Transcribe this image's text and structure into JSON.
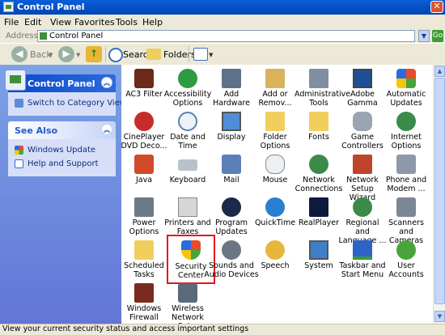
{
  "window": {
    "title": "Control Panel",
    "close_label": "✕"
  },
  "menu": [
    "File",
    "Edit",
    "View",
    "Favorites",
    "Tools",
    "Help"
  ],
  "address": {
    "label": "Address",
    "value": "Control Panel",
    "go_label": "Go"
  },
  "toolbar": {
    "back_label": "Back",
    "search_label": "Search",
    "folders_label": "Folders"
  },
  "sidebar": {
    "control_panel": {
      "title": "Control Panel",
      "link": "Switch to Category View"
    },
    "see_also": {
      "title": "See Also",
      "links": [
        "Windows Update",
        "Help and Support"
      ]
    }
  },
  "items": [
    {
      "label": "AC3 Filter"
    },
    {
      "label": "Accessibility Options"
    },
    {
      "label": "Add Hardware"
    },
    {
      "label": "Add or Remov..."
    },
    {
      "label": "Administrative Tools"
    },
    {
      "label": "Adobe Gamma"
    },
    {
      "label": "Automatic Updates"
    },
    {
      "label": "CinePlayer DVD Deco..."
    },
    {
      "label": "Date and Time"
    },
    {
      "label": "Display"
    },
    {
      "label": "Folder Options"
    },
    {
      "label": "Fonts"
    },
    {
      "label": "Game Controllers"
    },
    {
      "label": "Internet Options"
    },
    {
      "label": "Java"
    },
    {
      "label": "Keyboard"
    },
    {
      "label": "Mail"
    },
    {
      "label": "Mouse"
    },
    {
      "label": "Network Connections"
    },
    {
      "label": "Network Setup Wizard"
    },
    {
      "label": "Phone and Modem ..."
    },
    {
      "label": "Power Options"
    },
    {
      "label": "Printers and Faxes"
    },
    {
      "label": "Program Updates"
    },
    {
      "label": "QuickTime"
    },
    {
      "label": "RealPlayer"
    },
    {
      "label": "Regional and Language ..."
    },
    {
      "label": "Scanners and Cameras"
    },
    {
      "label": "Scheduled Tasks"
    },
    {
      "label": "Security Center"
    },
    {
      "label": "Sounds and Audio Devices"
    },
    {
      "label": "Speech"
    },
    {
      "label": "System"
    },
    {
      "label": "Taskbar and Start Menu"
    },
    {
      "label": "User Accounts"
    },
    {
      "label": "Windows Firewall"
    },
    {
      "label": "Wireless Network Set..."
    }
  ],
  "status": {
    "text": "View your current security status and access important settings"
  }
}
